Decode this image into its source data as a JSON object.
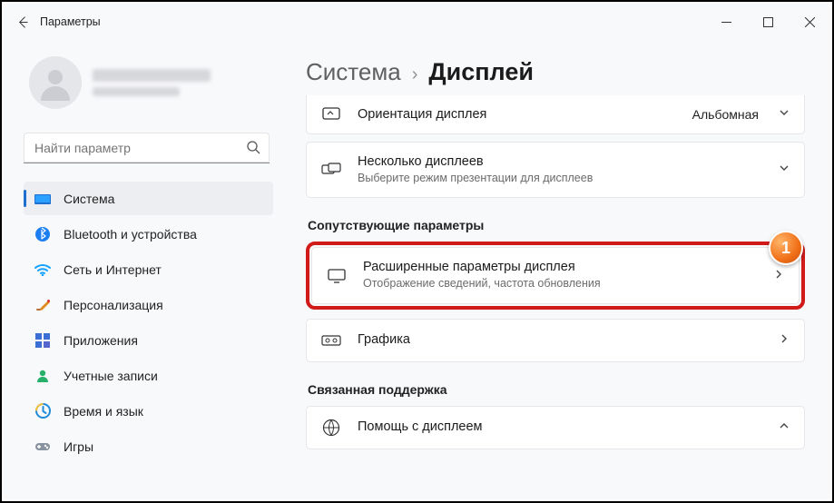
{
  "window": {
    "title": "Параметры"
  },
  "search": {
    "placeholder": "Найти параметр"
  },
  "sidebar": {
    "items": [
      {
        "label": "Система"
      },
      {
        "label": "Bluetooth и устройства"
      },
      {
        "label": "Сеть и Интернет"
      },
      {
        "label": "Персонализация"
      },
      {
        "label": "Приложения"
      },
      {
        "label": "Учетные записи"
      },
      {
        "label": "Время и язык"
      },
      {
        "label": "Игры"
      }
    ]
  },
  "breadcrumb": {
    "parent": "Система",
    "sep": "›",
    "current": "Дисплей"
  },
  "cards": {
    "orientation": {
      "title": "Ориентация дисплея",
      "value": "Альбомная"
    },
    "multi": {
      "title": "Несколько дисплеев",
      "sub": "Выберите режим презентации для дисплеев"
    },
    "advanced": {
      "title": "Расширенные параметры дисплея",
      "sub": "Отображение сведений, частота обновления"
    },
    "graphics": {
      "title": "Графика"
    },
    "help": {
      "title": "Помощь с дисплеем"
    }
  },
  "sections": {
    "related": "Сопутствующие параметры",
    "support": "Связанная поддержка"
  },
  "annotation": "1"
}
